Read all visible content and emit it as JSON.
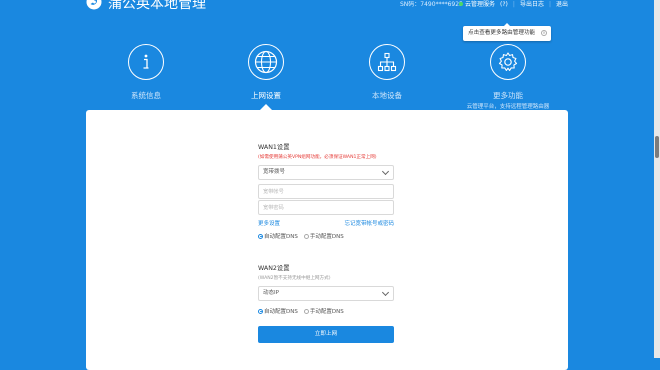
{
  "header": {
    "brand": "蒲公英本地管理",
    "sn": "SN码：7490****6925",
    "cloud_service": "云管理服务",
    "help": "(?)",
    "export_log": "导出日志",
    "logout": "退出",
    "cloud_dot_color": "#4cd964"
  },
  "tooltip": {
    "text": "点击查看更多路由管理功能"
  },
  "nav": {
    "items": [
      {
        "label": "系统信息",
        "icon": "info-icon"
      },
      {
        "label": "上网设置",
        "icon": "globe-icon",
        "active": true
      },
      {
        "label": "本地设备",
        "icon": "network-icon"
      },
      {
        "label": "更多功能",
        "icon": "gear-icon",
        "sub": "云管理平台，支持远程管理路由器"
      }
    ]
  },
  "wan1": {
    "title": "WAN1设置",
    "warning": "(如需使用蒲公英VPN组网功能，必须保证WAN1正常上网)",
    "mode": "宽带拨号",
    "account_placeholder": "宽带帐号",
    "password_placeholder": "宽带密码",
    "more_settings": "更多设置",
    "forgot": "忘记宽带帐号或密码",
    "dns_auto": "自动配置DNS",
    "dns_manual": "手动配置DNS"
  },
  "wan2": {
    "title": "WAN2设置",
    "note": "(WAN2暂不支持无线中继上网方式)",
    "mode": "动态IP",
    "dns_auto": "自动配置DNS",
    "dns_manual": "手动配置DNS"
  },
  "submit_label": "立即上网",
  "colors": {
    "primary": "#1a88e0",
    "warning": "#e53935"
  }
}
